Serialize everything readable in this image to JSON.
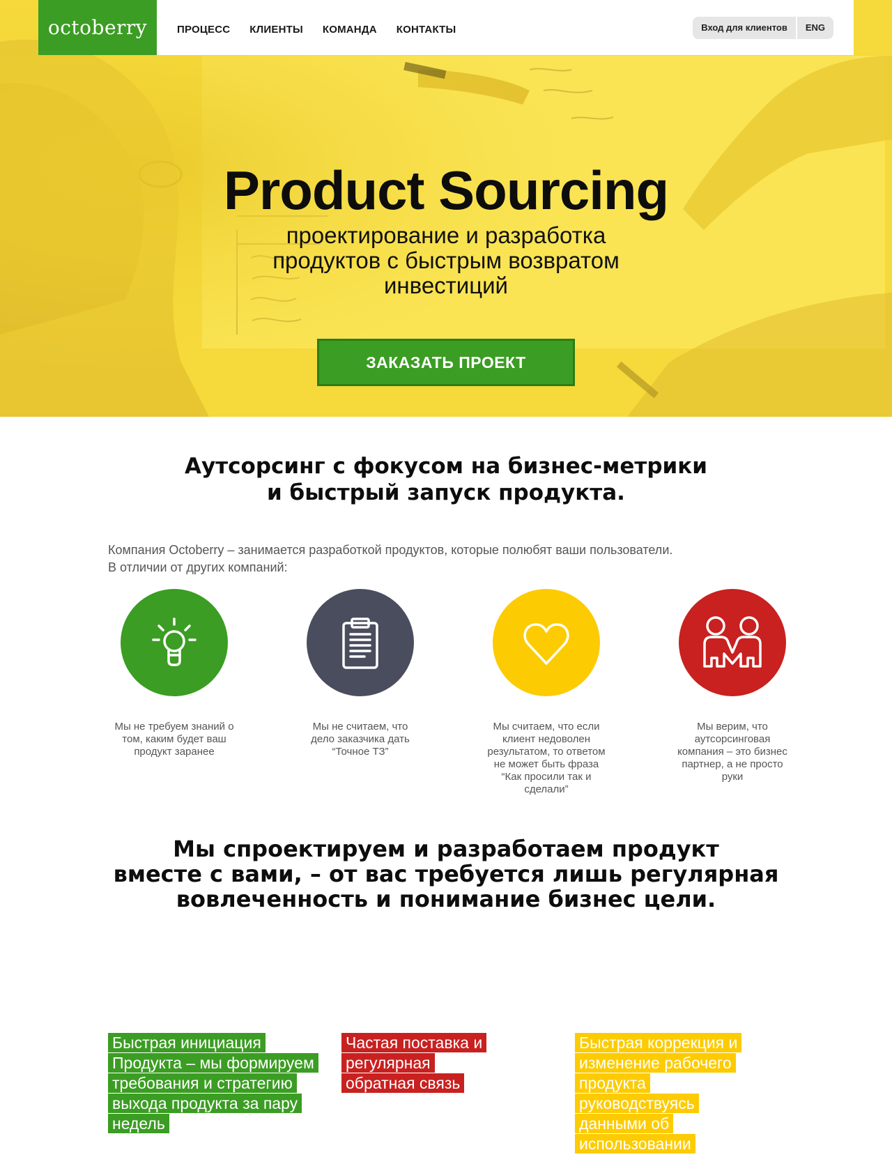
{
  "brand": {
    "logo": "octoberry",
    "green": "#3b9d23",
    "red": "#c92020",
    "yellow": "#fdcb02",
    "slate": "#494d5e"
  },
  "nav": {
    "items": [
      {
        "label": "ПРОЦЕСС"
      },
      {
        "label": "КЛИЕНТЫ"
      },
      {
        "label": "КОМАНДА"
      },
      {
        "label": "КОНТАКТЫ"
      }
    ],
    "client_login": "Вход для клиентов",
    "lang": "ENG"
  },
  "hero": {
    "title": "Product Sourcing",
    "subtitle": "проектирование и разработка продуктов с быстрым возвратом инвестиций",
    "cta": "ЗАКАЗАТЬ ПРОЕКТ"
  },
  "section1": {
    "title_line1": "Аутсорсинг с фокусом на бизнес-метрики",
    "title_line2": "и быстрый запуск продукта.",
    "intro_line1": "Компания Octoberry – занимается разработкой продуктов, которые полюбят ваши пользователи.",
    "intro_line2": "В отличии от других компаний:",
    "features": [
      {
        "icon": "lightbulb-icon",
        "text": "Мы не требуем знаний о том, каким будет ваш продукт заранее"
      },
      {
        "icon": "clipboard-icon",
        "text": "Мы не считаем, что дело заказчика дать “Точное ТЗ”"
      },
      {
        "icon": "heart-icon",
        "text": "Мы считаем, что если клиент недоволен результатом, то ответом не может быть фраза “Как просили так и сделали”"
      },
      {
        "icon": "partners-icon",
        "text": "Мы верим, что аутсорсинговая компания – это бизнес партнер, а не просто руки"
      }
    ]
  },
  "section2": {
    "line1": "Мы спроектируем и разработаем продукт",
    "line2": "вместе с вами, – от вас требуется лишь регулярная",
    "line3": "вовлеченность и понимание бизнес цели."
  },
  "highlights": [
    {
      "text": "Быстрая инициация Продукта – мы формируем требования и стратегию выхода продукта за пару недель"
    },
    {
      "text": "Частая поставка и регулярная обратная связь"
    },
    {
      "text": "Быстрая коррекция и изменение рабочего продукта руководствуясь данными об использовании"
    }
  ]
}
